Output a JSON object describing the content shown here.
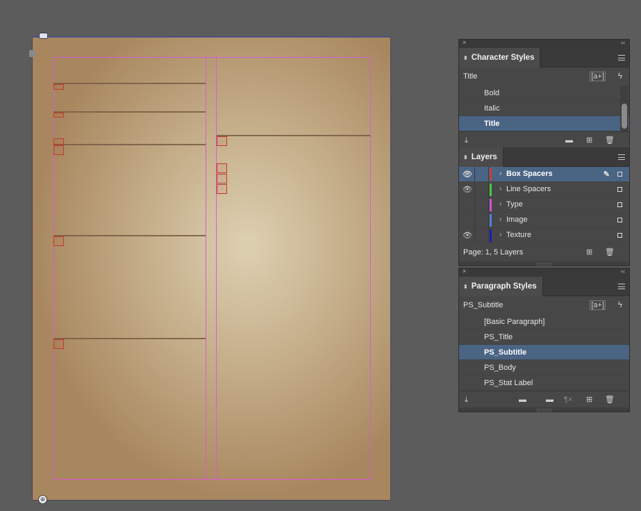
{
  "document": {
    "hint_top": "⌃",
    "hint_bottom": "⊕"
  },
  "character_styles": {
    "close": "×",
    "collapse": "‹‹",
    "tab_arrows": "⬍",
    "tab_label": "Character Styles",
    "current_style": "Title",
    "new_style_icon": "[a+]",
    "quick_apply_icon": "ϟ",
    "items": [
      "Bold",
      "Italic",
      "Title"
    ],
    "selected": "Title"
  },
  "layers": {
    "tab_arrows": "⬍",
    "tab_label": "Layers",
    "items": [
      {
        "name": "Box Spacers",
        "color": "#d03a3a",
        "visible": true,
        "selected": true
      },
      {
        "name": "Line Spacers",
        "color": "#43c94b",
        "visible": true,
        "selected": false
      },
      {
        "name": "Type",
        "color": "#d352d0",
        "visible": false,
        "selected": false
      },
      {
        "name": "Image",
        "color": "#4f7fe0",
        "visible": false,
        "selected": false
      },
      {
        "name": "Texture",
        "color": "#1b1bb8",
        "visible": true,
        "selected": false
      }
    ],
    "eye_glyph": "👁",
    "chevron": "›",
    "pen_glyph": "✎",
    "footer_text": "Page: 1, 5 Layers"
  },
  "paragraph_styles": {
    "close": "×",
    "collapse": "‹‹",
    "tab_arrows": "⬍",
    "tab_label": "Paragraph Styles",
    "current_style": "PS_Subtitle",
    "new_style_icon": "[a+]",
    "quick_apply_icon": "ϟ",
    "items": [
      "[Basic Paragraph]",
      "PS_Title",
      "PS_Subtitle",
      "PS_Body",
      "PS_Stat Label"
    ],
    "selected": "PS_Subtitle",
    "clear_overrides_icon": "¶×"
  },
  "icons": {
    "load_styles": "⤓",
    "folder": "▬",
    "add": "⊞",
    "trash": "🗑"
  },
  "colors": {
    "selection": "#4a6484",
    "guide": "#d95ad6",
    "spacer_box": "#c0392b"
  }
}
